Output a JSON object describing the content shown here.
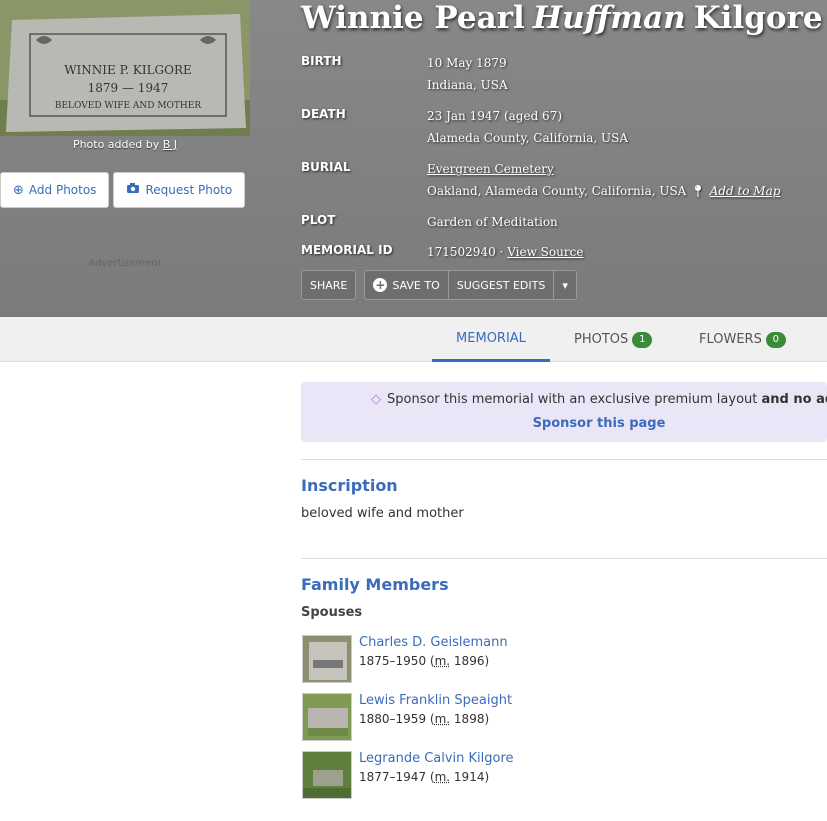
{
  "photo": {
    "caption_prefix": "Photo added by",
    "contributor": "B J",
    "stone_name": "WINNIE P. KILGORE",
    "stone_years": "1879 — 1947",
    "stone_epitaph": "BELOVED WIFE AND MOTHER"
  },
  "buttons": {
    "add_photos": "Add Photos",
    "request_photo": "Request Photo"
  },
  "ad_label": "Advertisement",
  "name": {
    "first": "Winnie Pearl",
    "maiden": "Huffman",
    "last": "Kilgore"
  },
  "facts": {
    "birth_label": "BIRTH",
    "birth_date": "10 May 1879",
    "birth_place": "Indiana, USA",
    "death_label": "DEATH",
    "death_date": "23 Jan 1947 (aged 67)",
    "death_place": "Alameda County, California, USA",
    "burial_label": "BURIAL",
    "burial_cemetery": "Evergreen Cemetery",
    "burial_place": "Oakland, Alameda County, California, USA",
    "add_to_map": "Add to Map",
    "plot_label": "PLOT",
    "plot_value": "Garden of Meditation",
    "memorial_label": "MEMORIAL ID",
    "memorial_id": "171502940",
    "separator": "·",
    "view_source": "View Source"
  },
  "actions": {
    "share": "SHARE",
    "save_to": "SAVE TO",
    "suggest_edits": "SUGGEST EDITS"
  },
  "tabs": [
    {
      "label": "MEMORIAL"
    },
    {
      "label": "PHOTOS",
      "count": "1"
    },
    {
      "label": "FLOWERS",
      "count": "0"
    }
  ],
  "sponsor": {
    "text": "Sponsor this memorial with an exclusive premium layout",
    "bold": "and no ads.",
    "link": "Sponsor this page"
  },
  "inscription": {
    "title": "Inscription",
    "text": "beloved wife and mother"
  },
  "family": {
    "title": "Family Members",
    "spouses_label": "Spouses",
    "spouses": [
      {
        "name": "Charles D. Geislemann",
        "years": "1875–1950",
        "marr_abbr": "m.",
        "marr_year": "1896"
      },
      {
        "name": "Lewis Franklin Speaight",
        "years": "1880–1959",
        "marr_abbr": "m.",
        "marr_year": "1898"
      },
      {
        "name": "Legrande Calvin Kilgore",
        "years": "1877–1947",
        "marr_abbr": "m.",
        "marr_year": "1914"
      }
    ]
  }
}
